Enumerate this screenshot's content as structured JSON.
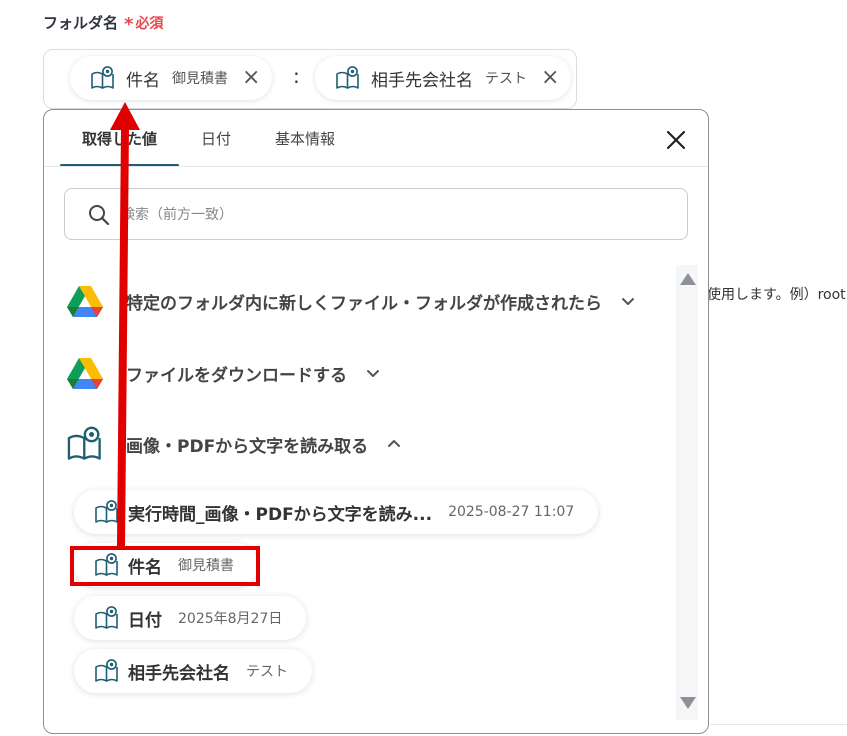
{
  "field": {
    "label": "フォルダ名",
    "required_mark": "*",
    "required_text": "必須",
    "separator": ":",
    "chips": [
      {
        "name": "件名",
        "value": "御見積書",
        "remove_icon": "×"
      },
      {
        "name": "相手先会社名",
        "value": "テスト",
        "remove_icon": "×"
      }
    ]
  },
  "background": {
    "hint_text": "使用します。例）root"
  },
  "panel": {
    "tabs": [
      {
        "label": "取得した値",
        "active": true
      },
      {
        "label": "日付",
        "active": false
      },
      {
        "label": "基本情報",
        "active": false
      }
    ],
    "search": {
      "placeholder": "検索（前方一致）",
      "value": ""
    },
    "sections": [
      {
        "title": "特定のフォルダ内に新しくファイル・フォルダが作成されたら",
        "icon": "google-drive-icon",
        "expanded": false
      },
      {
        "title": "ファイルをダウンロードする",
        "icon": "google-drive-icon",
        "expanded": false
      },
      {
        "title": "画像・PDFから文字を読み取る",
        "icon": "ocr-book-icon",
        "expanded": true
      }
    ],
    "items": [
      {
        "name": "実行時間_画像・PDFから文字を読み...",
        "value": "2025-08-27 11:07"
      },
      {
        "name": "件名",
        "value": "御見積書"
      },
      {
        "name": "日付",
        "value": "2025年8月27日"
      },
      {
        "name": "相手先会社名",
        "value": "テスト"
      }
    ]
  },
  "colors": {
    "required": "#e5484d",
    "tab_active": "#1f5e73",
    "annotation_red": "#e00000",
    "ocr_icon": "#1f5e73"
  }
}
